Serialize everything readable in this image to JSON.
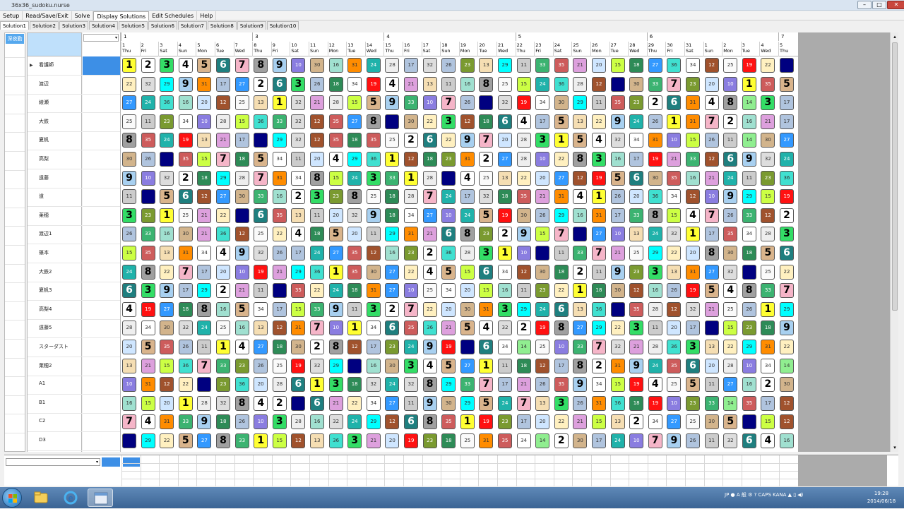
{
  "window": {
    "title": "36x36_sudoku.nurse"
  },
  "menu": [
    "Setup",
    "Read/Save/Exit",
    "Solve",
    "Display Solutions",
    "Edit Schedules",
    "Help"
  ],
  "menu_active_index": 3,
  "tabs": [
    "Solution1",
    "Solution2",
    "Solution3",
    "Solution4",
    "Solution5",
    "Solution6",
    "Solution7",
    "Solution8",
    "Solution9",
    "Solution10"
  ],
  "tab_active_index": 0,
  "left_header": "深夜勤",
  "weeks": [
    {
      "label": "1",
      "start": 0
    },
    {
      "label": "3",
      "start": 7
    },
    {
      "label": "4",
      "start": 14
    },
    {
      "label": "5",
      "start": 21
    },
    {
      "label": "6",
      "start": 28
    },
    {
      "label": "7",
      "start": 35
    }
  ],
  "days": [
    {
      "n": "1",
      "w": "Thu"
    },
    {
      "n": "2",
      "w": "Fri"
    },
    {
      "n": "3",
      "w": "Sat"
    },
    {
      "n": "4",
      "w": "Sun"
    },
    {
      "n": "5",
      "w": "Mon"
    },
    {
      "n": "6",
      "w": "Tue"
    },
    {
      "n": "7",
      "w": "Wed"
    },
    {
      "n": "8",
      "w": "Thu"
    },
    {
      "n": "9",
      "w": "Fri"
    },
    {
      "n": "10",
      "w": "Sat"
    },
    {
      "n": "11",
      "w": "Sun"
    },
    {
      "n": "12",
      "w": "Mon"
    },
    {
      "n": "13",
      "w": "Tue"
    },
    {
      "n": "14",
      "w": "Wed"
    },
    {
      "n": "15",
      "w": "Thu"
    },
    {
      "n": "16",
      "w": "Fri"
    },
    {
      "n": "17",
      "w": "Sat"
    },
    {
      "n": "18",
      "w": "Sun"
    },
    {
      "n": "19",
      "w": "Mon"
    },
    {
      "n": "20",
      "w": "Tue"
    },
    {
      "n": "21",
      "w": "Wed"
    },
    {
      "n": "22",
      "w": "Thu"
    },
    {
      "n": "23",
      "w": "Fri"
    },
    {
      "n": "24",
      "w": "Sat"
    },
    {
      "n": "25",
      "w": "Sun"
    },
    {
      "n": "26",
      "w": "Mon"
    },
    {
      "n": "27",
      "w": "Tue"
    },
    {
      "n": "28",
      "w": "Wed"
    },
    {
      "n": "29",
      "w": "Thu"
    },
    {
      "n": "30",
      "w": "Fri"
    },
    {
      "n": "31",
      "w": "Sat"
    },
    {
      "n": "1",
      "w": "Sun"
    },
    {
      "n": "2",
      "w": "Mon"
    },
    {
      "n": "3",
      "w": "Tue"
    },
    {
      "n": "4",
      "w": "Wed"
    },
    {
      "n": "5",
      "w": "Thu"
    }
  ],
  "staff": [
    "看護師",
    "渡辺",
    "綾瀬",
    "大鉄",
    "夏帆",
    "高梨",
    "遠藤",
    "道",
    "莱穂",
    "渡辺1",
    "篠本",
    "大鉄2",
    "夏帆3",
    "高梨4",
    "遠藤5",
    "スターダスト",
    "莱穂2",
    "A1",
    "B1",
    "C2",
    "D3"
  ],
  "selected_row_index": 0,
  "palette": {
    "1": "#ffff33",
    "2": "#ffffff",
    "3": "#33dd66",
    "4": "#ffffff",
    "5": "#d9b48c",
    "6": "#1f7f7f",
    "7": "#f5b5c8",
    "8": "#a0a0a0",
    "9": "#a8d0f0",
    "10": "#8a7de0",
    "11": "#cccccc",
    "12": "#a0522d",
    "13": "#f5deb3",
    "14": "#90ee90",
    "15": "#ccff44",
    "16": "#a0e0d0",
    "17": "#b0c4de",
    "18": "#2e8b57",
    "19": "#ff1111",
    "20": "#cfe6ff",
    "21": "#dda0dd",
    "22": "#fff0c0",
    "23": "#7a9a30",
    "24": "#20b2aa",
    "25": "#fafafa",
    "26": "#b0c4de",
    "27": "#3399ff",
    "28": "#eeeeee",
    "29": "#00ffff",
    "30": "#d2b48c",
    "31": "#ff8c00",
    "32": "#dddddd",
    "33": "#3cb371",
    "34": "#ffffff",
    "35": "#cd5c5c",
    "36": "#40e0d0",
    "N": "#000080"
  },
  "rows": [
    [
      "1",
      "2",
      "3",
      "4",
      "5",
      "6",
      "7",
      "8",
      "9",
      "10",
      "30",
      "16",
      "31",
      "24",
      "28",
      "17",
      "32",
      "26",
      "23",
      "13",
      "29",
      "11",
      "33",
      "35",
      "21",
      "20",
      "15",
      "18",
      "27",
      "36",
      "34",
      "12",
      "25",
      "19",
      "22",
      "N"
    ],
    [
      "22",
      "32",
      "29",
      "9",
      "31",
      "17",
      "27",
      "2",
      "6",
      "3",
      "26",
      "18",
      "34",
      "19",
      "4",
      "21",
      "13",
      "11",
      "16",
      "8",
      "25",
      "15",
      "24",
      "36",
      "28",
      "12",
      "N",
      "30",
      "33",
      "7",
      "23",
      "20",
      "10",
      "1",
      "35",
      "5"
    ],
    [
      "27",
      "24",
      "36",
      "16",
      "20",
      "12",
      "25",
      "13",
      "1",
      "32",
      "21",
      "28",
      "15",
      "5",
      "9",
      "33",
      "10",
      "7",
      "26",
      "N",
      "32",
      "19",
      "34",
      "30",
      "29",
      "11",
      "35",
      "23",
      "2",
      "6",
      "31",
      "4",
      "8",
      "14",
      "3",
      "17"
    ],
    [
      "25",
      "11",
      "23",
      "34",
      "10",
      "28",
      "15",
      "36",
      "33",
      "32",
      "12",
      "35",
      "27",
      "8",
      "N",
      "30",
      "22",
      "3",
      "12",
      "18",
      "6",
      "4",
      "17",
      "5",
      "13",
      "22",
      "9",
      "24",
      "26",
      "1",
      "31",
      "7",
      "2",
      "16",
      "21",
      "17"
    ],
    [
      "8",
      "35",
      "24",
      "19",
      "13",
      "21",
      "17",
      "N",
      "29",
      "32",
      "12",
      "35",
      "18",
      "35",
      "25",
      "2",
      "6",
      "22",
      "9",
      "7",
      "20",
      "28",
      "3",
      "1",
      "5",
      "4",
      "32",
      "34",
      "31",
      "10",
      "15",
      "26",
      "11",
      "14",
      "30",
      "27"
    ],
    [
      "30",
      "26",
      "N",
      "35",
      "15",
      "7",
      "18",
      "5",
      "34",
      "11",
      "20",
      "4",
      "29",
      "36",
      "1",
      "12",
      "18",
      "23",
      "31",
      "2",
      "27",
      "28",
      "10",
      "22",
      "8",
      "3",
      "16",
      "17",
      "19",
      "21",
      "33",
      "12",
      "6",
      "9",
      "32",
      "24"
    ],
    [
      "9",
      "10",
      "32",
      "2",
      "18",
      "29",
      "28",
      "7",
      "31",
      "34",
      "8",
      "15",
      "24",
      "3",
      "33",
      "1",
      "28",
      "N",
      "4",
      "25",
      "13",
      "22",
      "20",
      "27",
      "12",
      "19",
      "5",
      "6",
      "30",
      "35",
      "16",
      "21",
      "24",
      "11",
      "23",
      "36"
    ],
    [
      "11",
      "N",
      "5",
      "6",
      "12",
      "27",
      "30",
      "33",
      "16",
      "2",
      "3",
      "23",
      "8",
      "25",
      "18",
      "28",
      "7",
      "24",
      "17",
      "32",
      "18",
      "35",
      "21",
      "31",
      "4",
      "1",
      "26",
      "20",
      "36",
      "34",
      "12",
      "10",
      "9",
      "29",
      "15",
      "19"
    ],
    [
      "3",
      "23",
      "1",
      "25",
      "21",
      "22",
      "N",
      "6",
      "35",
      "13",
      "11",
      "20",
      "32",
      "9",
      "18",
      "34",
      "27",
      "10",
      "24",
      "5",
      "19",
      "30",
      "26",
      "29",
      "16",
      "31",
      "17",
      "33",
      "8",
      "15",
      "4",
      "7",
      "26",
      "33",
      "12",
      "2"
    ],
    [
      "26",
      "33",
      "16",
      "30",
      "21",
      "36",
      "12",
      "25",
      "22",
      "4",
      "18",
      "5",
      "20",
      "11",
      "29",
      "31",
      "21",
      "6",
      "8",
      "23",
      "2",
      "9",
      "15",
      "7",
      "N",
      "27",
      "10",
      "13",
      "24",
      "32",
      "1",
      "17",
      "35",
      "34",
      "28",
      "3"
    ],
    [
      "15",
      "35",
      "13",
      "31",
      "34",
      "4",
      "9",
      "32",
      "26",
      "17",
      "24",
      "27",
      "35",
      "12",
      "16",
      "23",
      "2",
      "36",
      "28",
      "3",
      "1",
      "10",
      "N",
      "11",
      "33",
      "7",
      "21",
      "25",
      "29",
      "22",
      "20",
      "8",
      "30",
      "18",
      "5",
      "6"
    ],
    [
      "24",
      "8",
      "22",
      "7",
      "17",
      "20",
      "10",
      "19",
      "21",
      "29",
      "36",
      "1",
      "35",
      "30",
      "27",
      "22",
      "4",
      "5",
      "15",
      "6",
      "34",
      "12",
      "30",
      "18",
      "2",
      "11",
      "9",
      "23",
      "3",
      "13",
      "31",
      "27",
      "32",
      "N",
      "25",
      "22"
    ],
    [
      "6",
      "3",
      "9",
      "17",
      "29",
      "2",
      "21",
      "11",
      "N",
      "35",
      "22",
      "24",
      "18",
      "31",
      "27",
      "10",
      "25",
      "34",
      "20",
      "15",
      "16",
      "11",
      "23",
      "22",
      "1",
      "18",
      "30",
      "12",
      "16",
      "26",
      "19",
      "5",
      "4",
      "8",
      "33",
      "7"
    ],
    [
      "4",
      "19",
      "27",
      "18",
      "8",
      "16",
      "5",
      "34",
      "17",
      "15",
      "33",
      "9",
      "11",
      "3",
      "2",
      "7",
      "22",
      "20",
      "30",
      "31",
      "3",
      "29",
      "24",
      "6",
      "13",
      "36",
      "N",
      "35",
      "28",
      "12",
      "32",
      "21",
      "25",
      "26",
      "1",
      "29"
    ],
    [
      "28",
      "34",
      "30",
      "32",
      "24",
      "25",
      "16",
      "13",
      "12",
      "31",
      "7",
      "10",
      "1",
      "34",
      "6",
      "35",
      "36",
      "21",
      "5",
      "4",
      "32",
      "2",
      "19",
      "8",
      "27",
      "29",
      "22",
      "3",
      "11",
      "20",
      "17",
      "N",
      "15",
      "23",
      "18",
      "9"
    ],
    [
      "20",
      "5",
      "35",
      "26",
      "11",
      "1",
      "4",
      "27",
      "18",
      "30",
      "2",
      "8",
      "12",
      "17",
      "23",
      "24",
      "9",
      "19",
      "N",
      "6",
      "34",
      "14",
      "25",
      "10",
      "33",
      "7",
      "32",
      "21",
      "28",
      "36",
      "3",
      "13",
      "22",
      "29",
      "31",
      "22"
    ],
    [
      "13",
      "21",
      "15",
      "36",
      "7",
      "33",
      "23",
      "26",
      "25",
      "19",
      "32",
      "29",
      "N",
      "16",
      "30",
      "3",
      "4",
      "5",
      "27",
      "1",
      "11",
      "18",
      "12",
      "17",
      "8",
      "2",
      "31",
      "9",
      "24",
      "35",
      "6",
      "20",
      "28",
      "10",
      "34",
      "14"
    ],
    [
      "10",
      "31",
      "12",
      "22",
      "N",
      "23",
      "36",
      "20",
      "28",
      "6",
      "1",
      "3",
      "18",
      "32",
      "24",
      "32",
      "8",
      "29",
      "33",
      "7",
      "17",
      "21",
      "26",
      "35",
      "9",
      "34",
      "15",
      "19",
      "4",
      "25",
      "5",
      "11",
      "27",
      "16",
      "2",
      "30"
    ],
    [
      "16",
      "15",
      "20",
      "1",
      "28",
      "32",
      "8",
      "4",
      "2",
      "N",
      "6",
      "21",
      "22",
      "34",
      "27",
      "11",
      "9",
      "30",
      "29",
      "5",
      "24",
      "7",
      "13",
      "3",
      "26",
      "31",
      "36",
      "18",
      "19",
      "10",
      "23",
      "33",
      "14",
      "35",
      "17",
      "12"
    ],
    [
      "7",
      "4",
      "31",
      "33",
      "9",
      "18",
      "26",
      "10",
      "3",
      "28",
      "16",
      "32",
      "24",
      "29",
      "12",
      "6",
      "8",
      "35",
      "1",
      "19",
      "23",
      "17",
      "20",
      "22",
      "21",
      "15",
      "13",
      "2",
      "34",
      "27",
      "25",
      "30",
      "5",
      "N",
      "15",
      "12"
    ],
    [
      "N",
      "29",
      "22",
      "5",
      "27",
      "8",
      "33",
      "1",
      "15",
      "12",
      "13",
      "36",
      "3",
      "21",
      "20",
      "19",
      "23",
      "18",
      "25",
      "31",
      "35",
      "34",
      "14",
      "2",
      "30",
      "17",
      "24",
      "10",
      "7",
      "9",
      "26",
      "11",
      "32",
      "6",
      "4",
      "16"
    ]
  ],
  "taskbar": {
    "tray_text": "JP",
    "time": "19:28",
    "date": "2014/06/18"
  }
}
